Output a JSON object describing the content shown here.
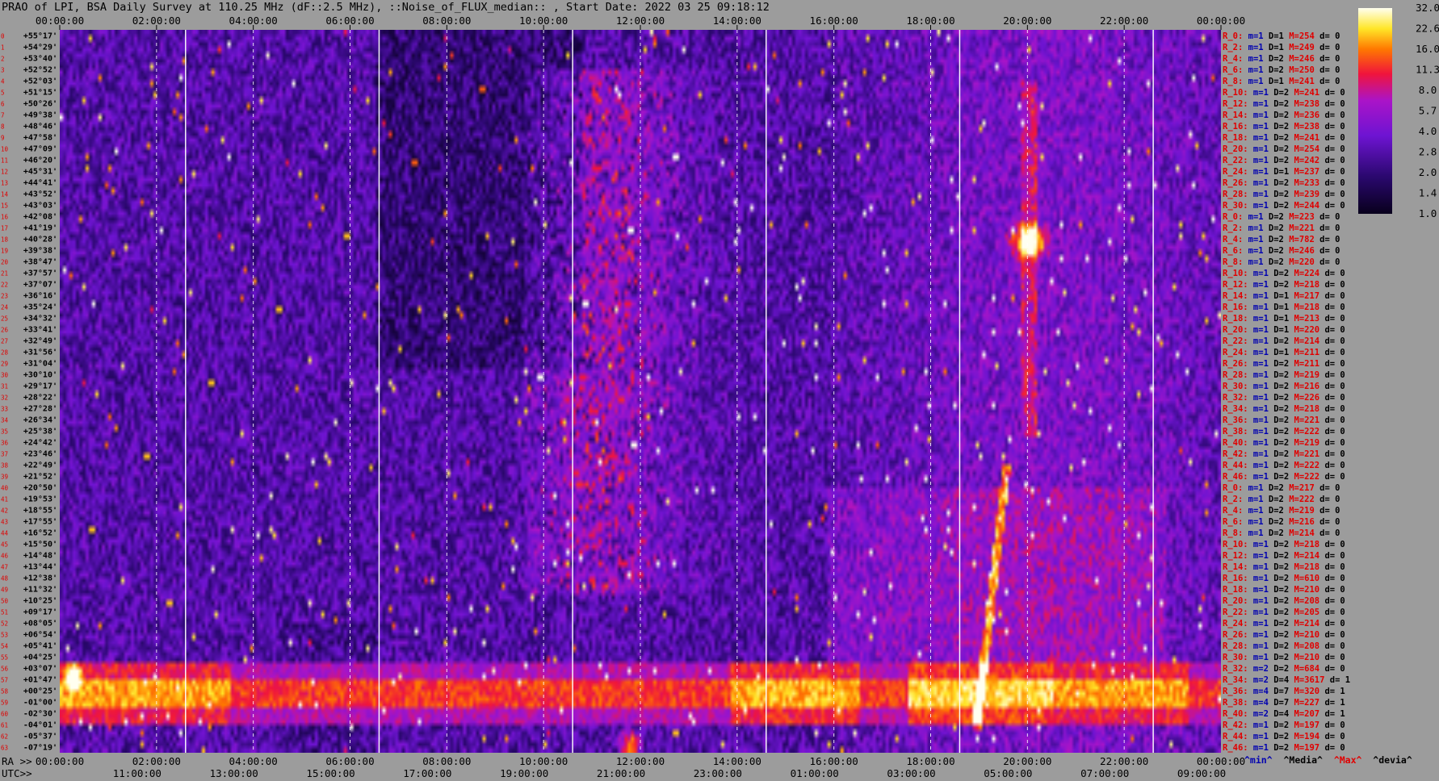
{
  "title": "PRAO of LPI, BSA Daily Survey at 110.25 MHz (dF::2.5 MHz), ::Noise_of_FLUX_median:: , Start Date: 2022 03 25 09:18:12",
  "top_time_labels": [
    "00:00:00",
    "02:00:00",
    "04:00:00",
    "06:00:00",
    "08:00:00",
    "10:00:00",
    "12:00:00",
    "14:00:00",
    "16:00:00",
    "18:00:00",
    "20:00:00",
    "22:00:00",
    "00:00:00"
  ],
  "ra_prefix": "RA >>",
  "ra_labels": [
    "00:00:00",
    "02:00:00",
    "04:00:00",
    "06:00:00",
    "08:00:00",
    "10:00:00",
    "12:00:00",
    "14:00:00",
    "16:00:00",
    "18:00:00",
    "20:00:00",
    "22:00:00",
    "00:00:00"
  ],
  "utc_prefix": "UTC>>",
  "utc_labels": [
    "11:00:00",
    "13:00:00",
    "15:00:00",
    "17:00:00",
    "19:00:00",
    "21:00:00",
    "23:00:00",
    "01:00:00",
    "03:00:00",
    "05:00:00",
    "07:00:00",
    "09:00:00"
  ],
  "declination_labels": [
    "+55°17'",
    "+54°29'",
    "+53°40'",
    "+52°52'",
    "+52°03'",
    "+51°15'",
    "+50°26'",
    "+49°38'",
    "+48°46'",
    "+47°58'",
    "+47°09'",
    "+46°20'",
    "+45°31'",
    "+44°41'",
    "+43°52'",
    "+43°03'",
    "+42°08'",
    "+41°19'",
    "+40°28'",
    "+39°38'",
    "+38°47'",
    "+37°57'",
    "+37°07'",
    "+36°16'",
    "+35°24'",
    "+34°32'",
    "+33°41'",
    "+32°49'",
    "+31°56'",
    "+31°04'",
    "+30°10'",
    "+29°17'",
    "+28°22'",
    "+27°28'",
    "+26°34'",
    "+25°38'",
    "+24°42'",
    "+23°46'",
    "+22°49'",
    "+21°52'",
    "+20°50'",
    "+19°53'",
    "+18°55'",
    "+17°55'",
    "+16°52'",
    "+15°50'",
    "+14°48'",
    "+13°44'",
    "+12°38'",
    "+11°32'",
    "+10°25'",
    "+09°17'",
    "+08°05'",
    "+06°54'",
    "+05°41'",
    "+04°25'",
    "+03°07'",
    "+01°47'",
    "+00°25'",
    "-01°00'",
    "-02°30'",
    "-04°01'",
    "-05°37'",
    "-07°19'"
  ],
  "row_labels": [
    {
      "r": "R_0:",
      "m": "m=1",
      "d": "D=1",
      "mx": "M=254",
      "dv": "d= 0"
    },
    {
      "r": "R_2:",
      "m": "m=1",
      "d": "D=1",
      "mx": "M=249",
      "dv": "d= 0"
    },
    {
      "r": "R_4:",
      "m": "m=1",
      "d": "D=2",
      "mx": "M=246",
      "dv": "d= 0"
    },
    {
      "r": "R_6:",
      "m": "m=1",
      "d": "D=2",
      "mx": "M=250",
      "dv": "d= 0"
    },
    {
      "r": "R_8:",
      "m": "m=1",
      "d": "D=1",
      "mx": "M=241",
      "dv": "d= 0"
    },
    {
      "r": "R_10:",
      "m": "m=1",
      "d": "D=2",
      "mx": "M=241",
      "dv": "d= 0"
    },
    {
      "r": "R_12:",
      "m": "m=1",
      "d": "D=2",
      "mx": "M=238",
      "dv": "d= 0"
    },
    {
      "r": "R_14:",
      "m": "m=1",
      "d": "D=2",
      "mx": "M=236",
      "dv": "d= 0"
    },
    {
      "r": "R_16:",
      "m": "m=1",
      "d": "D=2",
      "mx": "M=238",
      "dv": "d= 0"
    },
    {
      "r": "R_18:",
      "m": "m=1",
      "d": "D=2",
      "mx": "M=241",
      "dv": "d= 0"
    },
    {
      "r": "R_20:",
      "m": "m=1",
      "d": "D=2",
      "mx": "M=254",
      "dv": "d= 0"
    },
    {
      "r": "R_22:",
      "m": "m=1",
      "d": "D=2",
      "mx": "M=242",
      "dv": "d= 0"
    },
    {
      "r": "R_24:",
      "m": "m=1",
      "d": "D=1",
      "mx": "M=237",
      "dv": "d= 0"
    },
    {
      "r": "R_26:",
      "m": "m=1",
      "d": "D=2",
      "mx": "M=233",
      "dv": "d= 0"
    },
    {
      "r": "R_28:",
      "m": "m=1",
      "d": "D=2",
      "mx": "M=239",
      "dv": "d= 0"
    },
    {
      "r": "R_30:",
      "m": "m=1",
      "d": "D=2",
      "mx": "M=244",
      "dv": "d= 0"
    },
    {
      "r": "R_0:",
      "m": "m=1",
      "d": "D=2",
      "mx": "M=223",
      "dv": "d= 0"
    },
    {
      "r": "R_2:",
      "m": "m=1",
      "d": "D=2",
      "mx": "M=221",
      "dv": "d= 0"
    },
    {
      "r": "R_4:",
      "m": "m=1",
      "d": "D=2",
      "mx": "M=782",
      "dv": "d= 0"
    },
    {
      "r": "R_6:",
      "m": "m=1",
      "d": "D=2",
      "mx": "M=246",
      "dv": "d= 0"
    },
    {
      "r": "R_8:",
      "m": "m=1",
      "d": "D=2",
      "mx": "M=220",
      "dv": "d= 0"
    },
    {
      "r": "R_10:",
      "m": "m=1",
      "d": "D=2",
      "mx": "M=224",
      "dv": "d= 0"
    },
    {
      "r": "R_12:",
      "m": "m=1",
      "d": "D=2",
      "mx": "M=218",
      "dv": "d= 0"
    },
    {
      "r": "R_14:",
      "m": "m=1",
      "d": "D=1",
      "mx": "M=217",
      "dv": "d= 0"
    },
    {
      "r": "R_16:",
      "m": "m=1",
      "d": "D=1",
      "mx": "M=218",
      "dv": "d= 0"
    },
    {
      "r": "R_18:",
      "m": "m=1",
      "d": "D=1",
      "mx": "M=213",
      "dv": "d= 0"
    },
    {
      "r": "R_20:",
      "m": "m=1",
      "d": "D=1",
      "mx": "M=220",
      "dv": "d= 0"
    },
    {
      "r": "R_22:",
      "m": "m=1",
      "d": "D=2",
      "mx": "M=214",
      "dv": "d= 0"
    },
    {
      "r": "R_24:",
      "m": "m=1",
      "d": "D=1",
      "mx": "M=211",
      "dv": "d= 0"
    },
    {
      "r": "R_26:",
      "m": "m=1",
      "d": "D=2",
      "mx": "M=211",
      "dv": "d= 0"
    },
    {
      "r": "R_28:",
      "m": "m=1",
      "d": "D=2",
      "mx": "M=219",
      "dv": "d= 0"
    },
    {
      "r": "R_30:",
      "m": "m=1",
      "d": "D=2",
      "mx": "M=216",
      "dv": "d= 0"
    },
    {
      "r": "R_32:",
      "m": "m=1",
      "d": "D=2",
      "mx": "M=226",
      "dv": "d= 0"
    },
    {
      "r": "R_34:",
      "m": "m=1",
      "d": "D=2",
      "mx": "M=218",
      "dv": "d= 0"
    },
    {
      "r": "R_36:",
      "m": "m=1",
      "d": "D=2",
      "mx": "M=221",
      "dv": "d= 0"
    },
    {
      "r": "R_38:",
      "m": "m=1",
      "d": "D=2",
      "mx": "M=222",
      "dv": "d= 0"
    },
    {
      "r": "R_40:",
      "m": "m=1",
      "d": "D=2",
      "mx": "M=219",
      "dv": "d= 0"
    },
    {
      "r": "R_42:",
      "m": "m=1",
      "d": "D=2",
      "mx": "M=221",
      "dv": "d= 0"
    },
    {
      "r": "R_44:",
      "m": "m=1",
      "d": "D=2",
      "mx": "M=222",
      "dv": "d= 0"
    },
    {
      "r": "R_46:",
      "m": "m=1",
      "d": "D=2",
      "mx": "M=222",
      "dv": "d= 0"
    },
    {
      "r": "R_0:",
      "m": "m=1",
      "d": "D=2",
      "mx": "M=217",
      "dv": "d= 0"
    },
    {
      "r": "R_2:",
      "m": "m=1",
      "d": "D=2",
      "mx": "M=222",
      "dv": "d= 0"
    },
    {
      "r": "R_4:",
      "m": "m=1",
      "d": "D=2",
      "mx": "M=219",
      "dv": "d= 0"
    },
    {
      "r": "R_6:",
      "m": "m=1",
      "d": "D=2",
      "mx": "M=216",
      "dv": "d= 0"
    },
    {
      "r": "R_8:",
      "m": "m=1",
      "d": "D=2",
      "mx": "M=214",
      "dv": "d= 0"
    },
    {
      "r": "R_10:",
      "m": "m=1",
      "d": "D=2",
      "mx": "M=218",
      "dv": "d= 0"
    },
    {
      "r": "R_12:",
      "m": "m=1",
      "d": "D=2",
      "mx": "M=214",
      "dv": "d= 0"
    },
    {
      "r": "R_14:",
      "m": "m=1",
      "d": "D=2",
      "mx": "M=218",
      "dv": "d= 0"
    },
    {
      "r": "R_16:",
      "m": "m=1",
      "d": "D=2",
      "mx": "M=610",
      "dv": "d= 0"
    },
    {
      "r": "R_18:",
      "m": "m=1",
      "d": "D=2",
      "mx": "M=210",
      "dv": "d= 0"
    },
    {
      "r": "R_20:",
      "m": "m=1",
      "d": "D=2",
      "mx": "M=208",
      "dv": "d= 0"
    },
    {
      "r": "R_22:",
      "m": "m=1",
      "d": "D=2",
      "mx": "M=205",
      "dv": "d= 0"
    },
    {
      "r": "R_24:",
      "m": "m=1",
      "d": "D=2",
      "mx": "M=214",
      "dv": "d= 0"
    },
    {
      "r": "R_26:",
      "m": "m=1",
      "d": "D=2",
      "mx": "M=210",
      "dv": "d= 0"
    },
    {
      "r": "R_28:",
      "m": "m=1",
      "d": "D=2",
      "mx": "M=208",
      "dv": "d= 0"
    },
    {
      "r": "R_30:",
      "m": "m=1",
      "d": "D=2",
      "mx": "M=210",
      "dv": "d= 0"
    },
    {
      "r": "R_32:",
      "m": "m=2",
      "d": "D=2",
      "mx": "M=684",
      "dv": "d= 0"
    },
    {
      "r": "R_34:",
      "m": "m=2",
      "d": "D=4",
      "mx": "M=3617",
      "dv": "d= 1"
    },
    {
      "r": "R_36:",
      "m": "m=4",
      "d": "D=7",
      "mx": "M=320",
      "dv": "d= 1"
    },
    {
      "r": "R_38:",
      "m": "m=4",
      "d": "D=7",
      "mx": "M=227",
      "dv": "d= 1"
    },
    {
      "r": "R_40:",
      "m": "m=2",
      "d": "D=4",
      "mx": "M=207",
      "dv": "d= 1"
    },
    {
      "r": "R_42:",
      "m": "m=1",
      "d": "D=2",
      "mx": "M=197",
      "dv": "d= 0"
    },
    {
      "r": "R_44:",
      "m": "m=1",
      "d": "D=2",
      "mx": "M=194",
      "dv": "d= 0"
    },
    {
      "r": "R_46:",
      "m": "m=1",
      "d": "D=2",
      "mx": "M=197",
      "dv": "d= 0"
    }
  ],
  "colorbar_ticks": [
    "32.0",
    "22.6",
    "16.0",
    "11.3",
    "8.0",
    "5.7",
    "4.0",
    "2.8",
    "2.0",
    "1.4",
    "1.0"
  ],
  "legend": {
    "min": "^min^",
    "median": "^Media^",
    "max": "^Max^",
    "devia": "^devia^"
  },
  "colors": {
    "background": "#9c9c9c",
    "low": "#0a0030",
    "mid": "#6a10d0",
    "high": "#ff2020",
    "peak": "#ffffff",
    "min_text": "#0000b0",
    "max_text": "#e00000"
  },
  "chart_data": {
    "type": "heatmap",
    "x_axis": {
      "ra_start": "00:00:00",
      "ra_end": "00:00:00 (+24h)",
      "tick_step_hours": 2
    },
    "y_axis": {
      "dec_top": "+55°17'",
      "dec_bottom": "-07°19'",
      "rows": 64
    },
    "value_scale": {
      "min": 1.0,
      "max": 32.0,
      "log": true
    },
    "features": [
      {
        "name": "galactic-plane-band",
        "dec_from": "+03°07'",
        "dec_to": "-04°01'",
        "level": "high"
      },
      {
        "name": "strong-source",
        "ra": "20:00:00",
        "dec": "+40°28'"
      },
      {
        "name": "bright-source",
        "ra": "00:15:00",
        "dec": "+01°47'"
      },
      {
        "name": "bright-source",
        "ra": "11:45:00",
        "dec": "-07°19'"
      },
      {
        "name": "diagonal-trail",
        "ra_from": "18:55:00",
        "ra_to": "19:35:00"
      }
    ]
  }
}
